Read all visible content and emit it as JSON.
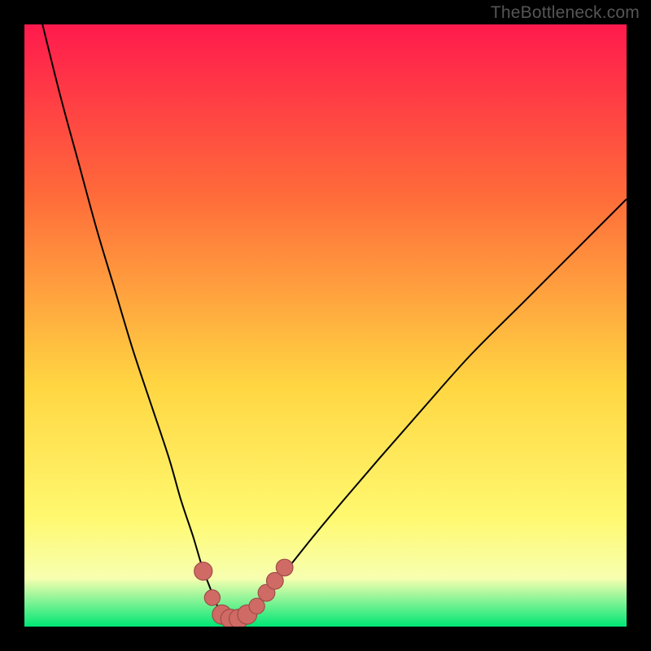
{
  "watermark": "TheBottleneck.com",
  "colors": {
    "frame": "#000000",
    "gradient_top": "#ff1a4d",
    "gradient_mid_upper": "#ff6a3a",
    "gradient_mid": "#ffd642",
    "gradient_mid_lower": "#fff970",
    "gradient_lowband": "#f7ffb0",
    "gradient_bottom": "#00e676",
    "curve": "#000000",
    "marker_fill": "#cf6a64",
    "marker_stroke": "#9c4a45"
  },
  "chart_data": {
    "type": "line",
    "title": "",
    "xlabel": "",
    "ylabel": "",
    "xlim": [
      0,
      100
    ],
    "ylim": [
      0,
      100
    ],
    "axes_visible": false,
    "series": [
      {
        "name": "bottleneck-curve",
        "x": [
          3,
          6,
          9,
          12,
          15,
          18,
          21,
          24,
          26,
          28,
          29.5,
          31,
          32,
          33,
          34,
          35,
          36,
          37.5,
          39,
          41,
          44,
          48,
          53,
          59,
          66,
          74,
          83,
          93,
          100
        ],
        "y": [
          100,
          88,
          77,
          66,
          56,
          46,
          37,
          28,
          21,
          15,
          10,
          6,
          3.5,
          2,
          1.4,
          1.3,
          1.6,
          2.4,
          4,
          6.5,
          10,
          15,
          21,
          28,
          36,
          45,
          54,
          64,
          71
        ]
      }
    ],
    "markers": [
      {
        "name": "point-a",
        "x": 29.7,
        "y": 9.2,
        "r": 1.5
      },
      {
        "name": "point-b",
        "x": 31.2,
        "y": 4.8,
        "r": 1.3
      },
      {
        "name": "point-c",
        "x": 32.8,
        "y": 2.0,
        "r": 1.6
      },
      {
        "name": "point-d",
        "x": 34.2,
        "y": 1.3,
        "r": 1.6
      },
      {
        "name": "point-e",
        "x": 35.6,
        "y": 1.3,
        "r": 1.6
      },
      {
        "name": "point-f",
        "x": 37.0,
        "y": 2.0,
        "r": 1.6
      },
      {
        "name": "point-g",
        "x": 38.6,
        "y": 3.4,
        "r": 1.3
      },
      {
        "name": "point-h",
        "x": 40.2,
        "y": 5.6,
        "r": 1.4
      },
      {
        "name": "point-i",
        "x": 41.6,
        "y": 7.6,
        "r": 1.4
      },
      {
        "name": "point-j",
        "x": 43.2,
        "y": 9.8,
        "r": 1.4
      }
    ]
  }
}
